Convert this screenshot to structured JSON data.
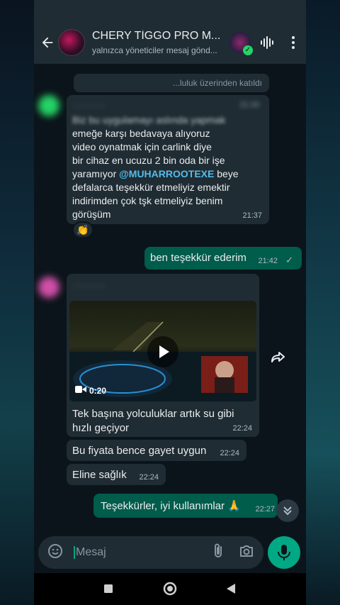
{
  "header": {
    "title": "CHERY TİGGO PRO M...",
    "subtitle": "yalnızca yöneticiler mesaj gönd..."
  },
  "system_notice": "...luluk üzerinden katıldı",
  "messages": {
    "msg1": {
      "sender_blurred": "··········",
      "time_blurred": "21:33",
      "line_blurred": "Biz bu uygulamayı aslında yapmak",
      "lines": [
        "emeğe karşı bedavaya alıyoruz",
        "video oynatmak için carlink diye",
        "bir cihaz en ucuzu 2 bin oda bir işe"
      ],
      "line4_before": "yaramıyor ",
      "mention": "@MUHARROOTEXE",
      "line4_after": " beye",
      "lines_end": [
        "defalarca teşekkür etmeliyiz emektir",
        "indirimden çok tşk etmeliyiz benim",
        "görüşüm"
      ],
      "time": "21:37",
      "reaction": "👏"
    },
    "msg2": {
      "text": "ben teşekkür ederim",
      "time": "21:42",
      "status": "✓"
    },
    "msg3": {
      "sender_blurred": "··········",
      "video_duration": "0:20",
      "caption_lines": [
        "Tek başına yolculuklar artık su gibi",
        "hızlı geçiyor"
      ],
      "time": "22:24"
    },
    "msg4": {
      "text": "Bu fiyata bence gayet uygun",
      "time": "22:24"
    },
    "msg5": {
      "text": "Eline sağlık",
      "time": "22:24"
    },
    "msg6": {
      "text": "Teşekkürler, iyi kullanımlar 🙏",
      "time": "22:27"
    }
  },
  "input": {
    "placeholder": "Mesaj"
  },
  "colors": {
    "accent": "#00a884",
    "outgoing_bubble": "#005c4b",
    "incoming_bubble": "#202c33",
    "header": "#1f2c34",
    "mention": "#53bdeb"
  },
  "icons": [
    "back-arrow",
    "waveform",
    "more-vertical",
    "sticker",
    "attach",
    "camera",
    "mic",
    "forward",
    "play",
    "video-camera",
    "chevron-down",
    "nav-square",
    "nav-circle",
    "nav-back"
  ]
}
